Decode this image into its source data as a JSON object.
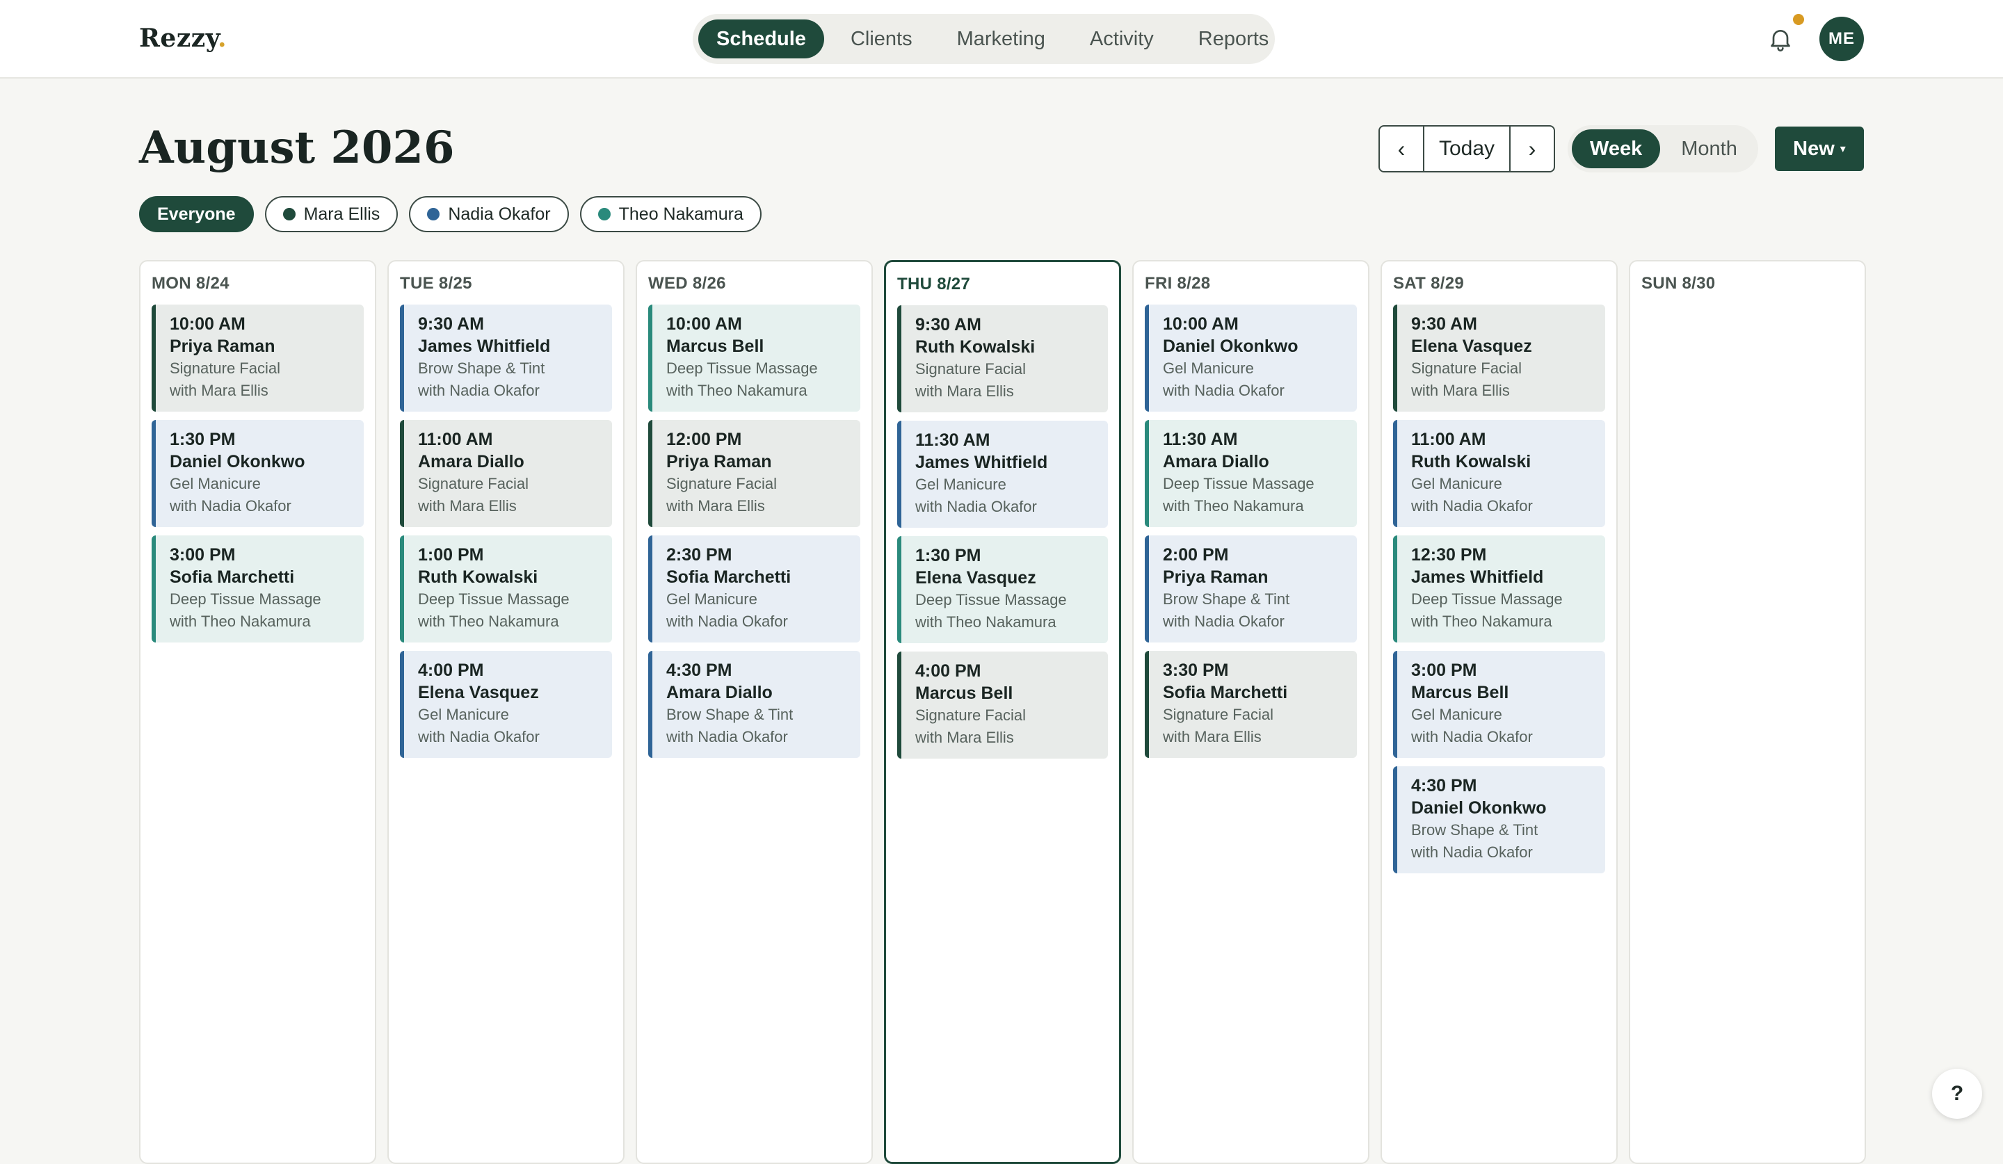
{
  "app": {
    "logo_text": "Rezzy",
    "logo_dot": "."
  },
  "nav": {
    "items": [
      {
        "label": "Schedule",
        "active": true
      },
      {
        "label": "Clients",
        "active": false
      },
      {
        "label": "Marketing",
        "active": false
      },
      {
        "label": "Activity",
        "active": false
      },
      {
        "label": "Reports",
        "active": false
      }
    ]
  },
  "header": {
    "notification_icon": "bell-icon",
    "avatar_initials": "ME",
    "page_title": "August 2026"
  },
  "controls": {
    "prev_label": "‹",
    "today_label": "Today",
    "next_label": "›",
    "views": [
      {
        "label": "Week",
        "active": true
      },
      {
        "label": "Month",
        "active": false
      }
    ],
    "new_label": "New",
    "new_caret": "▾"
  },
  "filters": [
    {
      "label": "Everyone",
      "active": true,
      "color": ""
    },
    {
      "label": "Mara Ellis",
      "active": false,
      "color": "#1f4a3b"
    },
    {
      "label": "Nadia Okafor",
      "active": false,
      "color": "#2f6496"
    },
    {
      "label": "Theo Nakamura",
      "active": false,
      "color": "#2a8a7c"
    }
  ],
  "colors": {
    "mara": "#1f4a3b",
    "nadia": "#2f6496",
    "theo": "#2a8a7c",
    "accent": "#1f4a3b",
    "notification": "#d89a22"
  },
  "days": [
    {
      "label": "MON 8/24",
      "today": false,
      "appointments": [
        {
          "time": "10:00 AM",
          "client": "Priya Raman",
          "service": "Signature Facial",
          "staff": "with Mara Ellis",
          "kind": "mara"
        },
        {
          "time": "1:30 PM",
          "client": "Daniel Okonkwo",
          "service": "Gel Manicure",
          "staff": "with Nadia Okafor",
          "kind": "nadia"
        },
        {
          "time": "3:00 PM",
          "client": "Sofia Marchetti",
          "service": "Deep Tissue Massage",
          "staff": "with Theo Nakamura",
          "kind": "theo"
        }
      ]
    },
    {
      "label": "TUE 8/25",
      "today": false,
      "appointments": [
        {
          "time": "9:30 AM",
          "client": "James Whitfield",
          "service": "Brow Shape & Tint",
          "staff": "with Nadia Okafor",
          "kind": "nadia"
        },
        {
          "time": "11:00 AM",
          "client": "Amara Diallo",
          "service": "Signature Facial",
          "staff": "with Mara Ellis",
          "kind": "mara"
        },
        {
          "time": "1:00 PM",
          "client": "Ruth Kowalski",
          "service": "Deep Tissue Massage",
          "staff": "with Theo Nakamura",
          "kind": "theo"
        },
        {
          "time": "4:00 PM",
          "client": "Elena Vasquez",
          "service": "Gel Manicure",
          "staff": "with Nadia Okafor",
          "kind": "nadia"
        }
      ]
    },
    {
      "label": "WED 8/26",
      "today": false,
      "appointments": [
        {
          "time": "10:00 AM",
          "client": "Marcus Bell",
          "service": "Deep Tissue Massage",
          "staff": "with Theo Nakamura",
          "kind": "theo"
        },
        {
          "time": "12:00 PM",
          "client": "Priya Raman",
          "service": "Signature Facial",
          "staff": "with Mara Ellis",
          "kind": "mara"
        },
        {
          "time": "2:30 PM",
          "client": "Sofia Marchetti",
          "service": "Gel Manicure",
          "staff": "with Nadia Okafor",
          "kind": "nadia"
        },
        {
          "time": "4:30 PM",
          "client": "Amara Diallo",
          "service": "Brow Shape & Tint",
          "staff": "with Nadia Okafor",
          "kind": "nadia"
        }
      ]
    },
    {
      "label": "THU 8/27",
      "today": true,
      "appointments": [
        {
          "time": "9:30 AM",
          "client": "Ruth Kowalski",
          "service": "Signature Facial",
          "staff": "with Mara Ellis",
          "kind": "mara"
        },
        {
          "time": "11:30 AM",
          "client": "James Whitfield",
          "service": "Gel Manicure",
          "staff": "with Nadia Okafor",
          "kind": "nadia"
        },
        {
          "time": "1:30 PM",
          "client": "Elena Vasquez",
          "service": "Deep Tissue Massage",
          "staff": "with Theo Nakamura",
          "kind": "theo"
        },
        {
          "time": "4:00 PM",
          "client": "Marcus Bell",
          "service": "Signature Facial",
          "staff": "with Mara Ellis",
          "kind": "mara"
        }
      ]
    },
    {
      "label": "FRI 8/28",
      "today": false,
      "appointments": [
        {
          "time": "10:00 AM",
          "client": "Daniel Okonkwo",
          "service": "Gel Manicure",
          "staff": "with Nadia Okafor",
          "kind": "nadia"
        },
        {
          "time": "11:30 AM",
          "client": "Amara Diallo",
          "service": "Deep Tissue Massage",
          "staff": "with Theo Nakamura",
          "kind": "theo"
        },
        {
          "time": "2:00 PM",
          "client": "Priya Raman",
          "service": "Brow Shape & Tint",
          "staff": "with Nadia Okafor",
          "kind": "nadia"
        },
        {
          "time": "3:30 PM",
          "client": "Sofia Marchetti",
          "service": "Signature Facial",
          "staff": "with Mara Ellis",
          "kind": "mara"
        }
      ]
    },
    {
      "label": "SAT 8/29",
      "today": false,
      "appointments": [
        {
          "time": "9:30 AM",
          "client": "Elena Vasquez",
          "service": "Signature Facial",
          "staff": "with Mara Ellis",
          "kind": "mara"
        },
        {
          "time": "11:00 AM",
          "client": "Ruth Kowalski",
          "service": "Gel Manicure",
          "staff": "with Nadia Okafor",
          "kind": "nadia"
        },
        {
          "time": "12:30 PM",
          "client": "James Whitfield",
          "service": "Deep Tissue Massage",
          "staff": "with Theo Nakamura",
          "kind": "theo"
        },
        {
          "time": "3:00 PM",
          "client": "Marcus Bell",
          "service": "Gel Manicure",
          "staff": "with Nadia Okafor",
          "kind": "nadia"
        },
        {
          "time": "4:30 PM",
          "client": "Daniel Okonkwo",
          "service": "Brow Shape & Tint",
          "staff": "with Nadia Okafor",
          "kind": "nadia"
        }
      ]
    },
    {
      "label": "SUN 8/30",
      "today": false,
      "appointments": []
    }
  ],
  "help": {
    "label": "?",
    "icon": "help-icon"
  }
}
